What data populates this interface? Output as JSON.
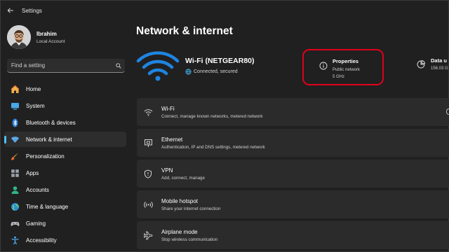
{
  "window": {
    "title": "Settings"
  },
  "profile": {
    "name": "Ibrahim",
    "account": "Local Account"
  },
  "search": {
    "placeholder": "Find a setting"
  },
  "sidebar": {
    "items": [
      {
        "label": "Home",
        "icon": "home-icon",
        "active": false
      },
      {
        "label": "System",
        "icon": "system-icon",
        "active": false
      },
      {
        "label": "Bluetooth & devices",
        "icon": "bluetooth-icon",
        "active": false
      },
      {
        "label": "Network & internet",
        "icon": "network-icon",
        "active": true
      },
      {
        "label": "Personalization",
        "icon": "brush-icon",
        "active": false
      },
      {
        "label": "Apps",
        "icon": "apps-icon",
        "active": false
      },
      {
        "label": "Accounts",
        "icon": "accounts-icon",
        "active": false
      },
      {
        "label": "Time & language",
        "icon": "time-language-icon",
        "active": false
      },
      {
        "label": "Gaming",
        "icon": "gaming-icon",
        "active": false
      },
      {
        "label": "Accessibility",
        "icon": "accessibility-icon",
        "active": false
      }
    ]
  },
  "main": {
    "title": "Network & internet",
    "connection": {
      "name": "Wi-Fi (NETGEAR80)",
      "status": "Connected, secured"
    },
    "properties": {
      "title": "Properties",
      "line1": "Public network",
      "line2": "5 GHz"
    },
    "data_usage": {
      "title": "Data u",
      "value": "156.03 G"
    },
    "cards": [
      {
        "title": "Wi-Fi",
        "subtitle": "Connect, manage known networks, metered network",
        "icon": "wifi-icon"
      },
      {
        "title": "Ethernet",
        "subtitle": "Authentication, IP and DNS settings, metered network",
        "icon": "ethernet-icon"
      },
      {
        "title": "VPN",
        "subtitle": "Add, connect, manage",
        "icon": "vpn-shield-icon"
      },
      {
        "title": "Mobile hotspot",
        "subtitle": "Share your internet connection",
        "icon": "hotspot-icon"
      },
      {
        "title": "Airplane mode",
        "subtitle": "Stop wireless communication",
        "icon": "airplane-icon"
      }
    ]
  },
  "colors": {
    "accent": "#4cc2ff",
    "highlight": "#e0001b",
    "background": "#202020",
    "card": "#2b2b2b"
  }
}
